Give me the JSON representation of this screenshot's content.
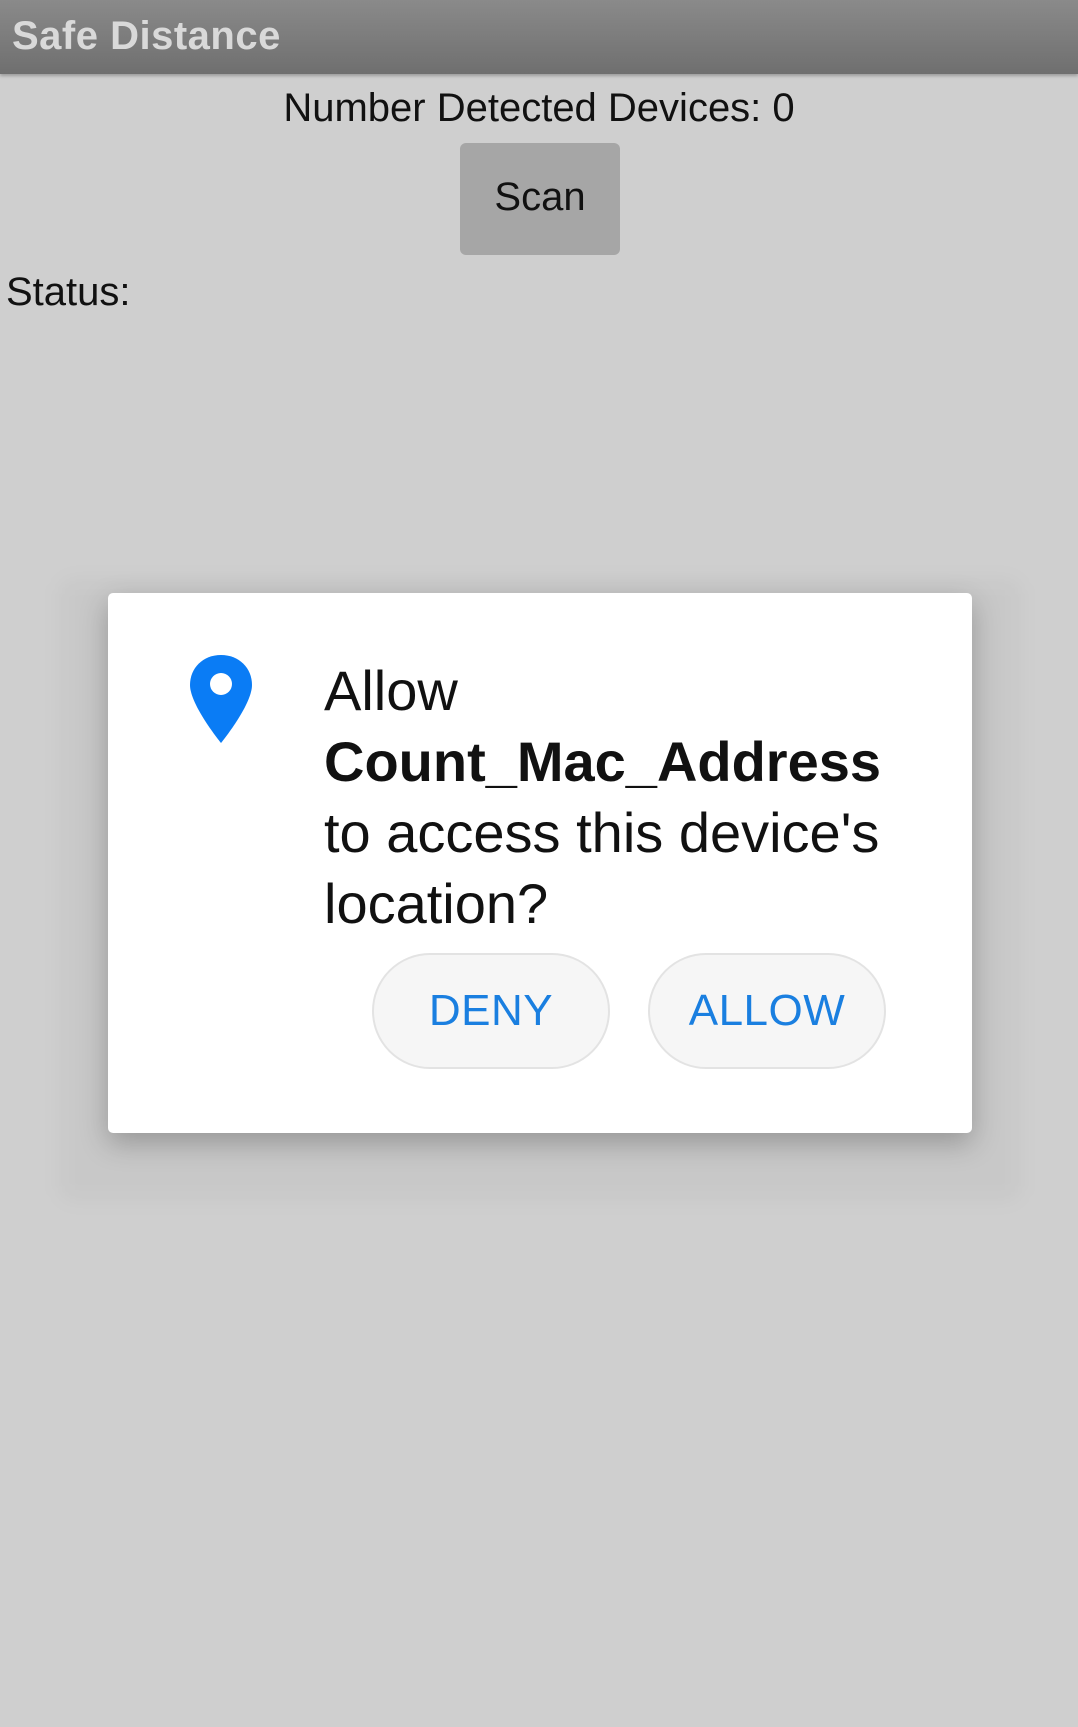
{
  "appbar": {
    "title": "Safe Distance"
  },
  "main": {
    "device_count_label": "Number Detected Devices: 0",
    "scan_button_label": "Scan",
    "status_label": "Status:"
  },
  "dialog": {
    "icon": "location-pin-icon",
    "message_prefix": "Allow",
    "app_name": "Count_Mac_Address",
    "message_suffix_line1": "to access this device's",
    "message_suffix_line2": "location?",
    "deny_label": "DENY",
    "allow_label": "ALLOW"
  },
  "colors": {
    "accent": "#1a7fe0",
    "icon_blue": "#0a7cf5",
    "background": "#cfcfcf",
    "appbar": "#7a7a7a",
    "scan_button": "#a6a6a6"
  }
}
